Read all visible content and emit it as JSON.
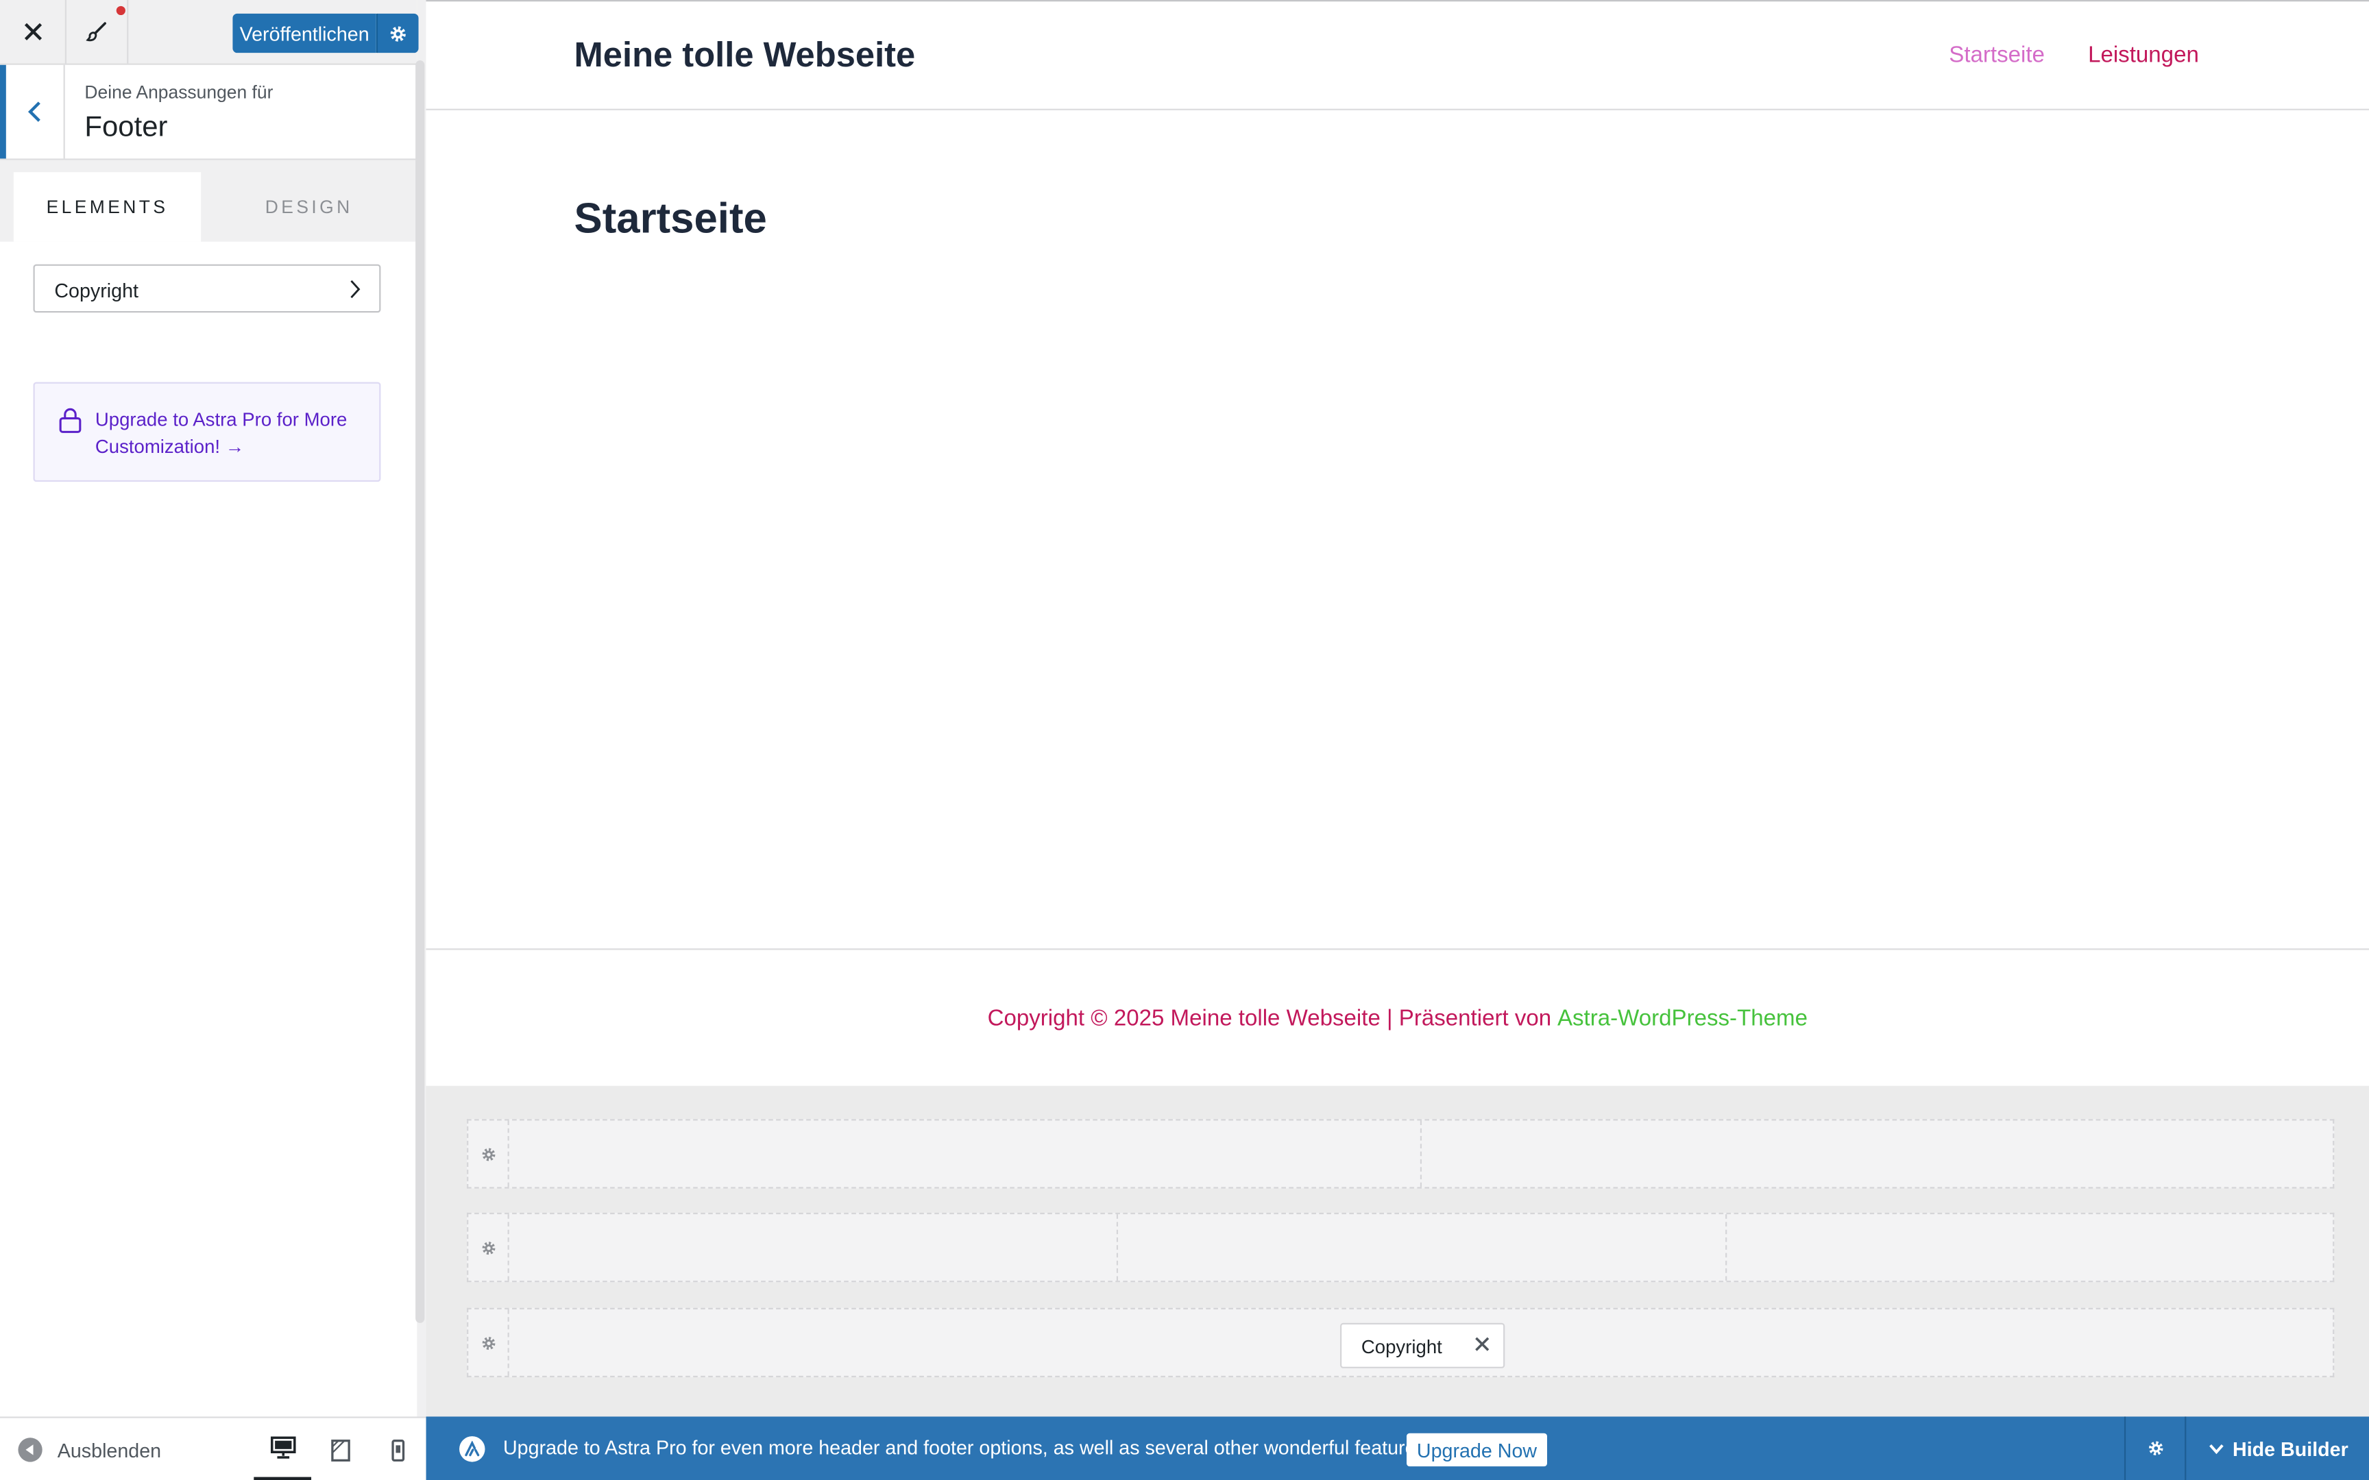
{
  "sidebar": {
    "publish_label": "Veröffentlichen",
    "section_label": "Deine Anpassungen für",
    "section_title": "Footer",
    "tabs": [
      {
        "label": "ELEMENTS",
        "active": true
      },
      {
        "label": "DESIGN",
        "active": false
      }
    ],
    "items": [
      {
        "label": "Copyright"
      }
    ],
    "upgrade_link": "Upgrade to Astra Pro for More Customization! →",
    "hide_label": "Ausblenden",
    "active_device": "desktop"
  },
  "site": {
    "title": "Meine tolle Webseite",
    "nav": [
      {
        "label": "Startseite",
        "color": "#d46cc8"
      },
      {
        "label": "Leistungen",
        "color": "#c2185b"
      }
    ],
    "page_heading": "Startseite",
    "footer_copyright": "Copyright © 2025 Meine tolle Webseite | Präsentiert von",
    "footer_link": "Astra-WordPress-Theme"
  },
  "builder": {
    "copyright_chip": "Copyright",
    "bottom_bar_message": "Upgrade to Astra Pro for even more header and footer options, as well as several other wonderful features!",
    "upgrade_button": "Upgrade Now",
    "hide_builder_label": "Hide Builder"
  },
  "colors": {
    "wp_blue": "#2271b1",
    "builder_bar": "#2c74b3",
    "accent_pink": "#c2185b",
    "link_green": "#46c23c",
    "pro_purple": "#5b21c9"
  },
  "icons": [
    "close-icon",
    "paintbrush-icon",
    "gear-icon",
    "chevron-left-icon",
    "chevron-right-icon",
    "lock-icon",
    "arrow-left-circle-icon",
    "desktop-icon",
    "tablet-icon",
    "mobile-icon",
    "astra-logo-icon",
    "chevron-down-icon"
  ]
}
